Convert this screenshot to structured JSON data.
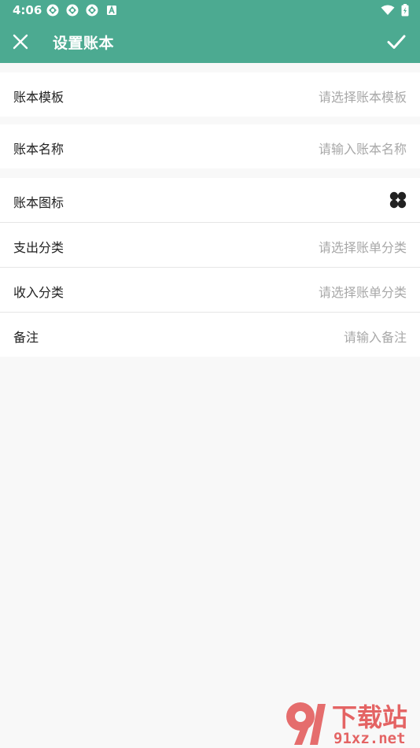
{
  "status": {
    "time": "4:06"
  },
  "header": {
    "title": "设置账本"
  },
  "form": {
    "template": {
      "label": "账本模板",
      "placeholder": "请选择账本模板"
    },
    "name": {
      "label": "账本名称",
      "placeholder": "请输入账本名称"
    },
    "icon": {
      "label": "账本图标",
      "icon": "clover-icon"
    },
    "expense": {
      "label": "支出分类",
      "placeholder": "请选择账单分类"
    },
    "income": {
      "label": "收入分类",
      "placeholder": "请选择账单分类"
    },
    "note": {
      "label": "备注",
      "placeholder": "请输入备注"
    }
  },
  "watermark": {
    "brand_top": "下载站",
    "brand_bottom": "91xz.net"
  },
  "colors": {
    "primary": "#4caa91",
    "background": "#f8f8f8",
    "watermark": "#e14b4b"
  }
}
